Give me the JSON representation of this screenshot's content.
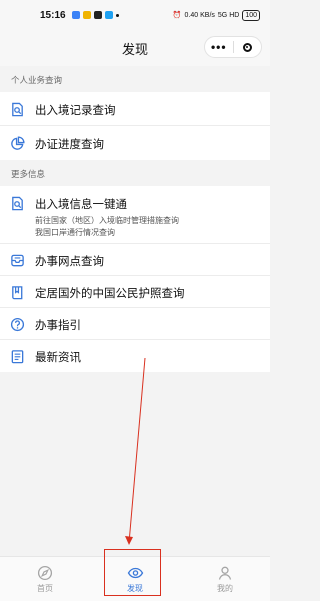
{
  "status_bar": {
    "time": "15:16",
    "app_icon_colors": [
      "#3b82f6",
      "#f0b400",
      "#222222",
      "#1ea1f2"
    ],
    "network": "0.40 KB/s",
    "signal": "5G HD",
    "battery": "100"
  },
  "header": {
    "title": "发现",
    "more": "•••"
  },
  "sections": [
    {
      "title": "个人业务查询",
      "items": [
        {
          "label": "出入境记录查询",
          "icon": "document-search-icon"
        },
        {
          "label": "办证进度查询",
          "icon": "pie-chart-icon"
        }
      ]
    },
    {
      "title": "更多信息",
      "items": [
        {
          "label": "出入境信息一键通",
          "icon": "document-search-icon",
          "sub1": "前往国家（地区）入境临时管理措施查询",
          "sub2": "我国口岸通行情况查询"
        },
        {
          "label": "办事网点查询",
          "icon": "inbox-icon"
        },
        {
          "label": "定居国外的中国公民护照查询",
          "icon": "passport-book-icon"
        },
        {
          "label": "办事指引",
          "icon": "question-circle-icon"
        },
        {
          "label": "最新资讯",
          "icon": "news-list-icon"
        }
      ]
    }
  ],
  "tabbar": {
    "tabs": [
      {
        "label": "首页",
        "icon": "compass-icon",
        "active": false
      },
      {
        "label": "发现",
        "icon": "eye-icon",
        "active": true
      },
      {
        "label": "我的",
        "icon": "user-icon",
        "active": false
      }
    ]
  },
  "colors": {
    "accent": "#3a78d8",
    "annotation": "#d9301f"
  }
}
